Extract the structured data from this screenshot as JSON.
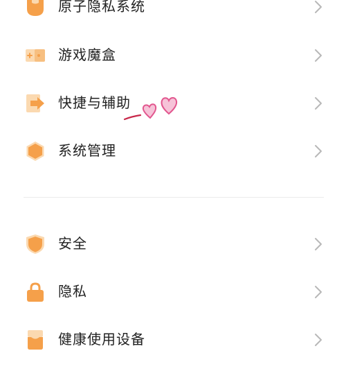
{
  "colors": {
    "accent": "#f5a04a",
    "accent_light": "#fbd9b0",
    "text": "#222222",
    "chevron": "#b8b8b8",
    "doodle_pink": "#e2568e",
    "doodle_red": "#c8284a"
  },
  "menu": {
    "group1": [
      {
        "label": "原子隐私系统",
        "icon": "atomic-privacy-icon"
      },
      {
        "label": "游戏魔盒",
        "icon": "game-box-icon"
      },
      {
        "label": "快捷与辅助",
        "icon": "shortcut-arrow-icon"
      },
      {
        "label": "系统管理",
        "icon": "hexagon-icon"
      }
    ],
    "group2": [
      {
        "label": "安全",
        "icon": "shield-icon"
      },
      {
        "label": "隐私",
        "icon": "lock-icon"
      },
      {
        "label": "健康使用设备",
        "icon": "health-hourglass-icon"
      }
    ]
  }
}
